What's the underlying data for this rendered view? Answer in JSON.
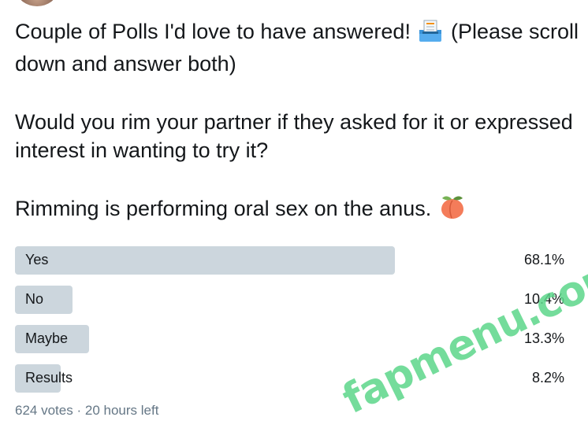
{
  "tweet": {
    "line1": "Couple of Polls I'd love to have answered!",
    "line1_rest": "(Please scroll down and answer both)",
    "paragraph2": "Would you rim your partner if they asked for it or expressed interest in wanting to try it?",
    "paragraph3": "Rimming is performing oral sex on the anus.",
    "emoji1": "ballot-box-icon",
    "emoji2": "peach-icon"
  },
  "poll": {
    "options": [
      {
        "label": "Yes",
        "percent_text": "68.1%",
        "percent": 68.1
      },
      {
        "label": "No",
        "percent_text": "10.4%",
        "percent": 10.4
      },
      {
        "label": "Maybe",
        "percent_text": "13.3%",
        "percent": 13.3
      },
      {
        "label": "Results",
        "percent_text": "8.2%",
        "percent": 8.2
      }
    ],
    "votes": "624 votes",
    "separator": "·",
    "time_left": "20 hours left",
    "bar_color": "#ccd6dd"
  },
  "watermark": {
    "text": "fapmenu.com",
    "color": "#5cd68a"
  }
}
